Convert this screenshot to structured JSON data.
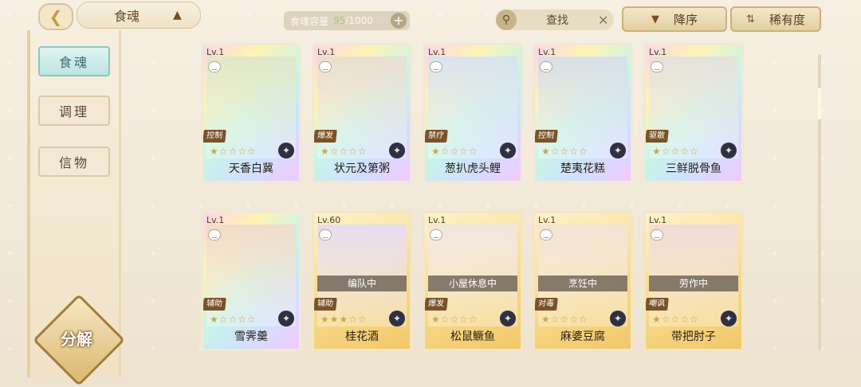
{
  "header": {
    "back_label": "<",
    "title": "食魂",
    "capacity_label": "食魂容量",
    "capacity_current": "95",
    "capacity_max": "/1000",
    "capacity_add": "+",
    "search_placeholder": "查找",
    "search_clear": "✕",
    "sort_order_label": "降序",
    "sort_key_label": "稀有度"
  },
  "sidebar": {
    "items": [
      {
        "label": "食魂",
        "active": true
      },
      {
        "label": "调理",
        "active": false
      },
      {
        "label": "信物",
        "active": false
      }
    ],
    "decompose_label": "分解"
  },
  "cards": [
    {
      "level": "Lv.1",
      "name": "天香白冀",
      "role": "控制",
      "status": "",
      "frame": "rainbow",
      "art_color": "#dfe8c9",
      "stars": 1
    },
    {
      "level": "Lv.1",
      "name": "状元及第粥",
      "role": "爆发",
      "status": "",
      "frame": "rainbow",
      "art_color": "#e9dfd2",
      "stars": 1
    },
    {
      "level": "Lv.1",
      "name": "葱扒虎头鲤",
      "role": "禁疗",
      "status": "",
      "frame": "rainbow",
      "art_color": "#d9e3ee",
      "stars": 1
    },
    {
      "level": "Lv.1",
      "name": "楚夷花糕",
      "role": "控制",
      "status": "",
      "frame": "rainbow",
      "art_color": "#d7dfe8",
      "stars": 1
    },
    {
      "level": "Lv.1",
      "name": "三鲜脱骨鱼",
      "role": "驱散",
      "status": "",
      "frame": "rainbow",
      "art_color": "#e5e2dc",
      "stars": 1
    },
    {
      "level": "Lv.1",
      "name": "雪霁羹",
      "role": "辅助",
      "status": "",
      "frame": "rainbow",
      "art_color": "#f1dccb",
      "stars": 1
    },
    {
      "level": "Lv.60",
      "name": "桂花酒",
      "role": "辅助",
      "status": "编队中",
      "frame": "gold",
      "art_color": "#e7dcef",
      "stars": 3
    },
    {
      "level": "Lv.1",
      "name": "松鼠鳜鱼",
      "role": "爆发",
      "status": "小屋休息中",
      "frame": "gold",
      "art_color": "#f1e6df",
      "stars": 1
    },
    {
      "level": "Lv.1",
      "name": "麻婆豆腐",
      "role": "对毒",
      "status": "烹饪中",
      "frame": "gold",
      "art_color": "#f3e4d6",
      "stars": 1
    },
    {
      "level": "Lv.1",
      "name": "带把肘子",
      "role": "嘲讽",
      "status": "劳作中",
      "frame": "gold",
      "art_color": "#f0dcd6",
      "stars": 1
    }
  ]
}
